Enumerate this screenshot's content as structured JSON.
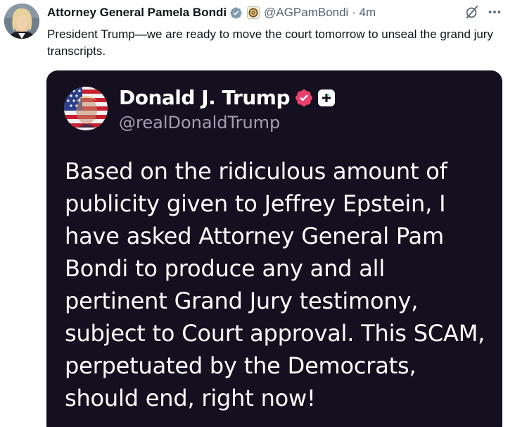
{
  "post": {
    "author_name": "Attorney General Pamela Bondi",
    "handle": "@AGPamBondi",
    "separator": "·",
    "time": "4m",
    "text": "President Trump—we are ready to move the court tomorrow to unseal the grand jury transcripts.",
    "icons": {
      "avatar": "avatar-photo",
      "verified": "verified-gray-icon",
      "affiliate": "government-seal-icon",
      "grok": "grok-icon",
      "more": "more-icon"
    }
  },
  "embedded": {
    "name": "Donald J. Trump",
    "handle": "@realDonaldTrump",
    "text": "Based on the ridiculous amount of publicity given to Jeffrey Epstein, I have asked Attorney General Pam Bondi to produce any and all pertinent Grand Jury testimony, subject to Court approval. This SCAM, perpetuated by the Democrats, should end, right now!",
    "icons": {
      "avatar": "flag-avatar",
      "verified": "verified-pink-icon",
      "plus": "plus-badge-icon"
    },
    "colors": {
      "background": "#15101f",
      "verified": "#e8416c"
    }
  }
}
